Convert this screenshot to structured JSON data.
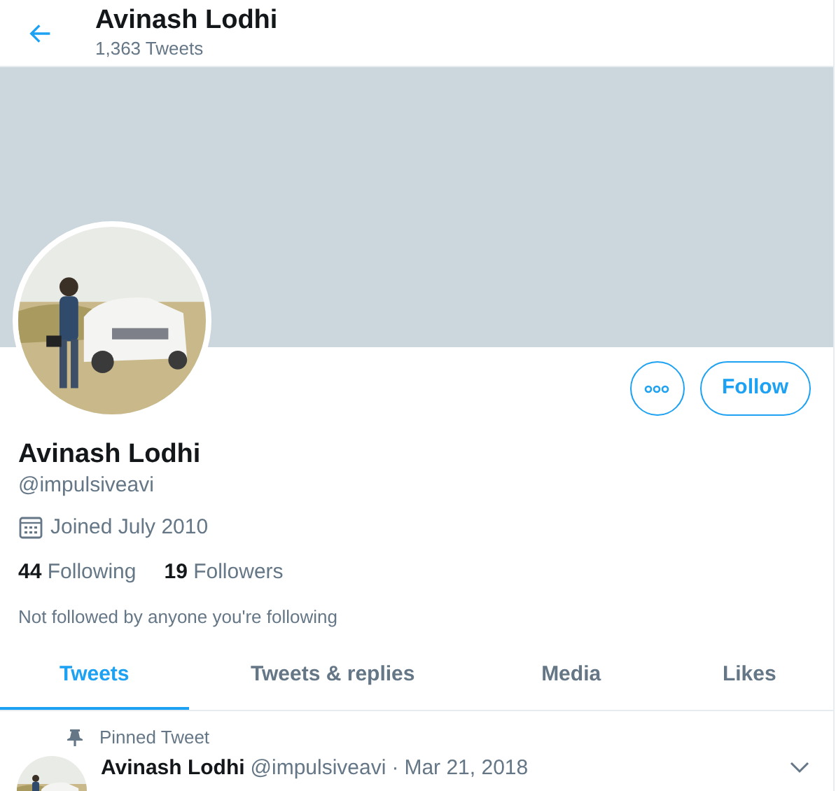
{
  "header": {
    "title": "Avinash Lodhi",
    "subtitle": "1,363 Tweets"
  },
  "profile": {
    "name": "Avinash Lodhi",
    "handle": "@impulsiveavi",
    "joined": "Joined July 2010",
    "following_count": "44",
    "following_label": "Following",
    "followers_count": "19",
    "followers_label": "Followers",
    "note": "Not followed by anyone you're following",
    "follow_button": "Follow"
  },
  "tabs": [
    {
      "label": "Tweets",
      "selected": true
    },
    {
      "label": "Tweets & replies",
      "selected": false
    },
    {
      "label": "Media",
      "selected": false
    },
    {
      "label": "Likes",
      "selected": false
    }
  ],
  "pinned_tweet": {
    "label": "Pinned Tweet",
    "name": "Avinash Lodhi",
    "handle": "@impulsiveavi",
    "separator": "·",
    "date": "Mar 21, 2018"
  }
}
